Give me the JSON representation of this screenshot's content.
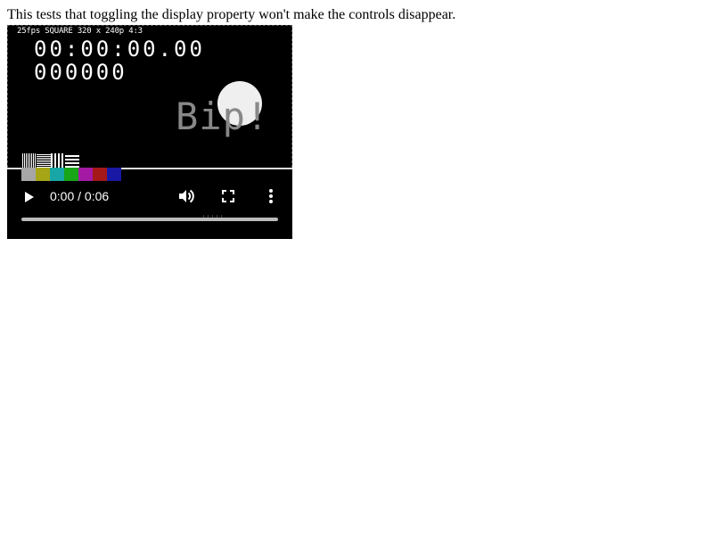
{
  "description": "This tests that toggling the display property won't make the controls disappear.",
  "video": {
    "caption": "25fps SQUARE 320 x 240p 4:3",
    "timecode": "00:00:00.00",
    "frame_counter": "000000",
    "overlay_text": "Bip!",
    "test_patterns": [
      "vertical-fine",
      "horizontal-fine",
      "vertical-coarse",
      "horizontal-coarse"
    ],
    "color_bars": [
      "#a6a6a6",
      "#a5a517",
      "#18a6a6",
      "#18a518",
      "#a51aa5",
      "#a51818",
      "#1818a5"
    ]
  },
  "controls": {
    "play_icon": "play-icon",
    "current_time": "0:00",
    "separator": "/",
    "duration": "0:06",
    "time_text": "0:00 / 0:06",
    "volume_icon": "volume-icon",
    "fullscreen_icon": "fullscreen-icon",
    "more_icon": "more-vertical-icon",
    "progress": 0
  }
}
